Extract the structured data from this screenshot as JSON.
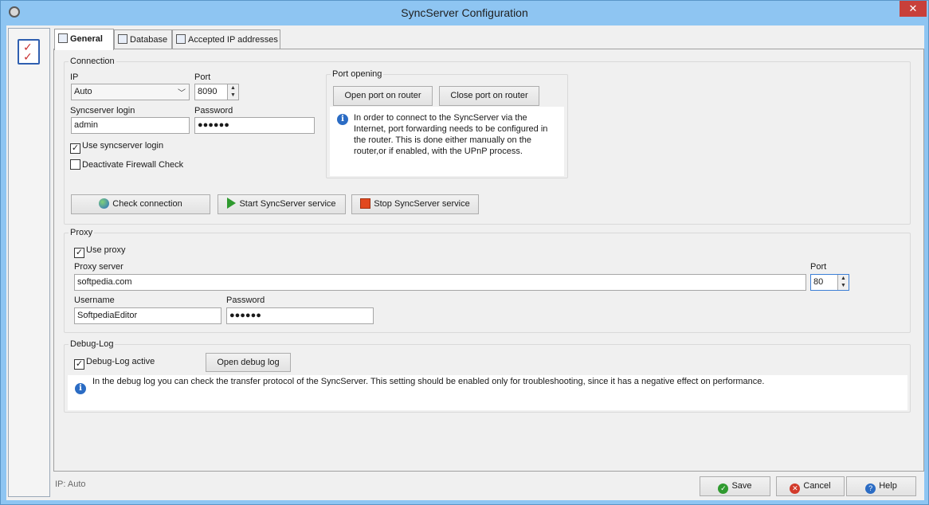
{
  "window": {
    "title": "SyncServer Configuration",
    "close_glyph": "✕"
  },
  "tabs": [
    {
      "label": "General",
      "icon": "checklist-icon",
      "active": true
    },
    {
      "label": "Database",
      "icon": "database-icon",
      "active": false
    },
    {
      "label": "Accepted IP addresses",
      "icon": "network-icon",
      "active": false
    }
  ],
  "connection": {
    "group_label": "Connection",
    "ip_label": "IP",
    "ip_value": "Auto",
    "port_label": "Port",
    "port_value": "8090",
    "login_label": "Syncserver login",
    "login_value": "admin",
    "password_label": "Password",
    "password_value": "●●●●●●",
    "use_login_label": "Use syncserver login",
    "use_login_checked": true,
    "deactivate_firewall_label": "Deactivate Firewall Check",
    "deactivate_firewall_checked": false,
    "port_opening": {
      "group_label": "Port opening",
      "open_button": "Open port on router",
      "close_button": "Close port on router",
      "info_text": "In order to connect to the SyncServer via the Internet, port forwarding  needs to be configured in the router. This is done either manually on the router,or if enabled, with the UPnP process."
    },
    "check_button": "Check connection",
    "start_button": "Start SyncServer service",
    "stop_button": "Stop SyncServer service"
  },
  "proxy": {
    "group_label": "Proxy",
    "use_proxy_label": "Use proxy",
    "use_proxy_checked": true,
    "server_label": "Proxy server",
    "server_value": "softpedia.com",
    "port_label": "Port",
    "port_value": "80",
    "username_label": "Username",
    "username_value": "SoftpediaEditor",
    "password_label": "Password",
    "password_value": "●●●●●●"
  },
  "debug": {
    "group_label": "Debug-Log",
    "active_label": "Debug-Log active",
    "active_checked": true,
    "open_button": "Open debug log",
    "info_text": "In the debug log you can check the transfer protocol of the SyncServer. This setting should be enabled only for troubleshooting, since it has a negative effect on performance."
  },
  "footer": {
    "status": "IP: Auto",
    "save": "Save",
    "cancel": "Cancel",
    "help": "Help"
  },
  "colors": {
    "frame": "#8ec5f2",
    "close": "#c8403a",
    "info_icon": "#2b6cc4"
  }
}
